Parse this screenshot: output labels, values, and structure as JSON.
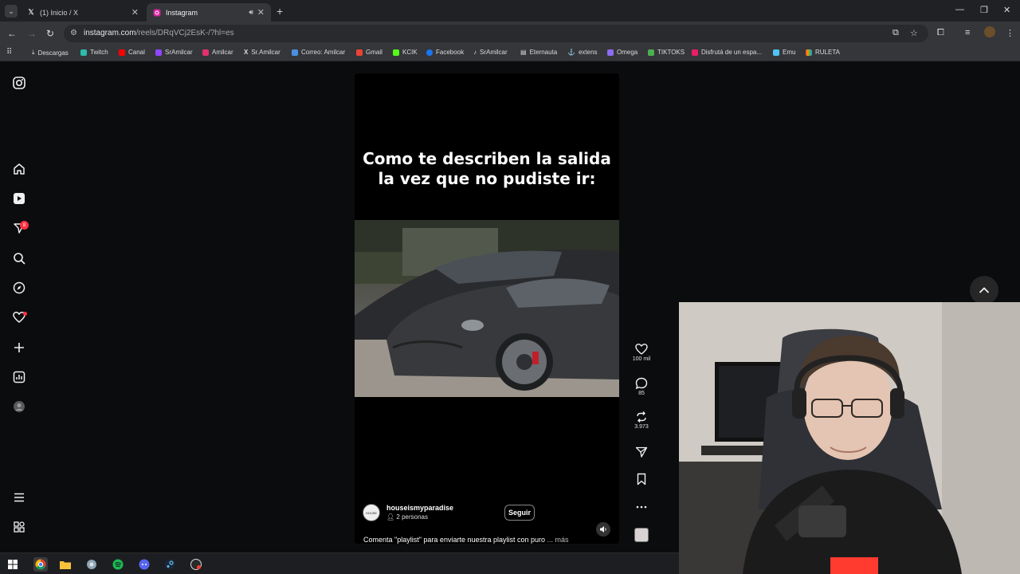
{
  "browser": {
    "tabs": [
      {
        "title": "(1) Inicio / X",
        "icon": "x-logo-icon"
      },
      {
        "title": "Instagram",
        "icon": "instagram-logo-icon",
        "active": true
      }
    ],
    "url_main": "instagram.com",
    "url_path": "/reels/DRqVCj2EsK-/?hl=es",
    "bookmarks": [
      {
        "label": "Descargas",
        "color": "#9aa0a6"
      },
      {
        "label": "Twitch",
        "color": "#2dbbaa"
      },
      {
        "label": "Canal",
        "color": "#ff0000"
      },
      {
        "label": "SrAmilcar",
        "color": "#9146ff"
      },
      {
        "label": "Amilcar",
        "color": "#e1306c"
      },
      {
        "label": "Sr.Amilcar",
        "color": "#ffffff"
      },
      {
        "label": "Correo: Amilcar",
        "color": "#4a90e2"
      },
      {
        "label": "Gmail",
        "color": "#ea4335"
      },
      {
        "label": "KCIK",
        "color": "#53fc18"
      },
      {
        "label": "Facebook",
        "color": "#1877f2"
      },
      {
        "label": "SrAmilcar",
        "color": "#ffffff"
      },
      {
        "label": "Eternauta",
        "color": "#cccccc"
      },
      {
        "label": "extens",
        "color": "#dddddd"
      },
      {
        "label": "Omega",
        "color": "#8b6cf2"
      },
      {
        "label": "TIKTOKS",
        "color": "#4caf50"
      },
      {
        "label": "Disfrutá de un espa...",
        "color": "#e91e63"
      },
      {
        "label": "Emu",
        "color": "#4fc3f7"
      },
      {
        "label": "RULETA",
        "color": "#ff9800"
      }
    ]
  },
  "instagram": {
    "nav": {
      "notifications_badge": "8"
    },
    "reel": {
      "caption_title": "Como te describen la salida la vez que no pudiste ir:",
      "avatar_text": "HOUSE",
      "username": "houseismyparadise",
      "people": "2 personas",
      "follow_label": "Seguir",
      "description": "Comenta \"playlist\" para enviarte nuestra playlist con puro",
      "more_label": "... más"
    },
    "actions": {
      "likes": "100 mil",
      "comments": "85",
      "reposts": "3.973"
    }
  },
  "colors": {
    "accent_red": "#ff3040",
    "background": "#0b0c0e"
  }
}
